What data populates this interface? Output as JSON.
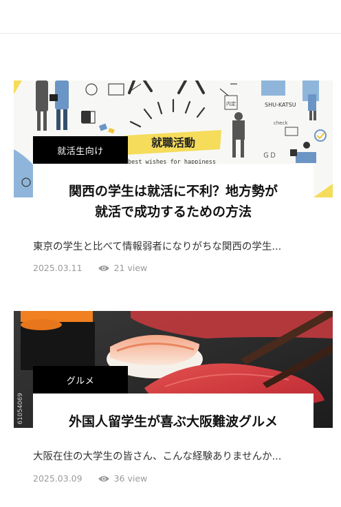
{
  "posts": [
    {
      "category": "就活生向け",
      "title_line1": "関西の学生は就活に不利？地方勢が",
      "title_line2": "就活で成功するための方法",
      "excerpt": "東京の学生と比べて情報弱者になりがちな関西の学生...",
      "date": "2025.03.11",
      "views": "21 view",
      "image": {
        "banner": "就職活動",
        "tagline": "best wishes for happiness",
        "tag_shukatsu": "SHU-KATSU",
        "tag_naitei": "内定",
        "tag_check": "check"
      }
    },
    {
      "category": "グルメ",
      "title": "外国人留学生が喜ぶ大阪難波グルメ",
      "excerpt": "大阪在住の大学生の皆さん、こんな経験ありませんか...",
      "date": "2025.03.09",
      "views": "36 view",
      "image": {
        "stock_id": "61054069"
      }
    }
  ],
  "colors": {
    "category_bg": "#000000",
    "accent_yellow": "#f5dc5a",
    "accent_blue": "#8fb6da",
    "meta_gray": "#9a9a9a"
  }
}
